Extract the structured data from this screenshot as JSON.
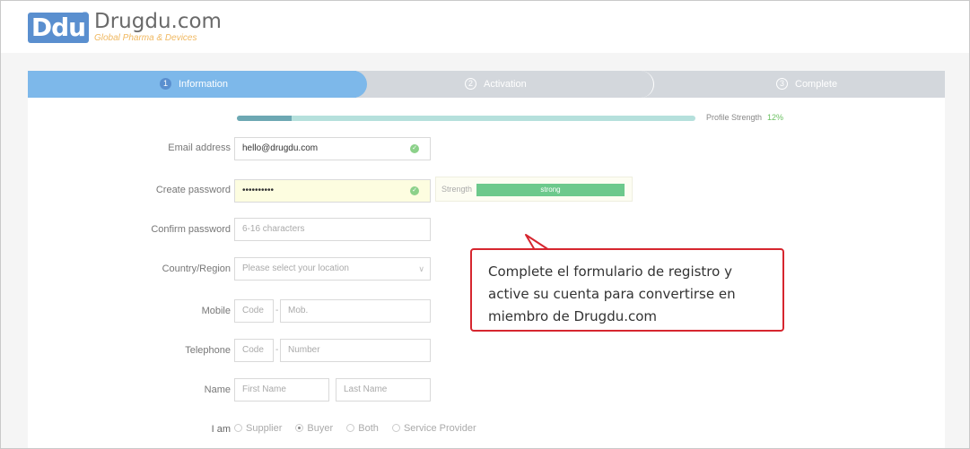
{
  "brand": {
    "logo_text": "Ddu",
    "reg_mark": "®",
    "name": "Drugdu.com",
    "tagline": "Global Pharma & Devices"
  },
  "steps": [
    {
      "num": "1",
      "label": "Information",
      "active": true
    },
    {
      "num": "2",
      "label": "Activation",
      "active": false
    },
    {
      "num": "3",
      "label": "Complete",
      "active": false
    }
  ],
  "profile": {
    "label": "Profile Strength",
    "value": "12%",
    "fraction": 0.12
  },
  "form": {
    "email": {
      "label": "Email address",
      "value": "hello@drugdu.com"
    },
    "password": {
      "label": "Create password",
      "value": "••••••••••",
      "strength_label": "Strength",
      "strength_value": "strong"
    },
    "confirm": {
      "label": "Confirm password",
      "placeholder": "6-16 characters"
    },
    "country": {
      "label": "Country/Region",
      "placeholder": "Please select your location"
    },
    "mobile": {
      "label": "Mobile",
      "code_placeholder": "Code",
      "number_placeholder": "Mob."
    },
    "telephone": {
      "label": "Telephone",
      "code_placeholder": "Code",
      "number_placeholder": "Number"
    },
    "name": {
      "label": "Name",
      "first_placeholder": "First Name",
      "last_placeholder": "Last Name"
    },
    "iam": {
      "label": "I am",
      "options": [
        "Supplier",
        "Buyer",
        "Both",
        "Service Provider"
      ],
      "selected": "Buyer"
    }
  },
  "callout": {
    "text": "Complete el formulario de registro y active su cuenta para convertirse en miembro de Drugdu.com"
  },
  "colors": {
    "accent": "#7db8ea",
    "callout_border": "#d6262f",
    "strength": "#6dc98c"
  }
}
